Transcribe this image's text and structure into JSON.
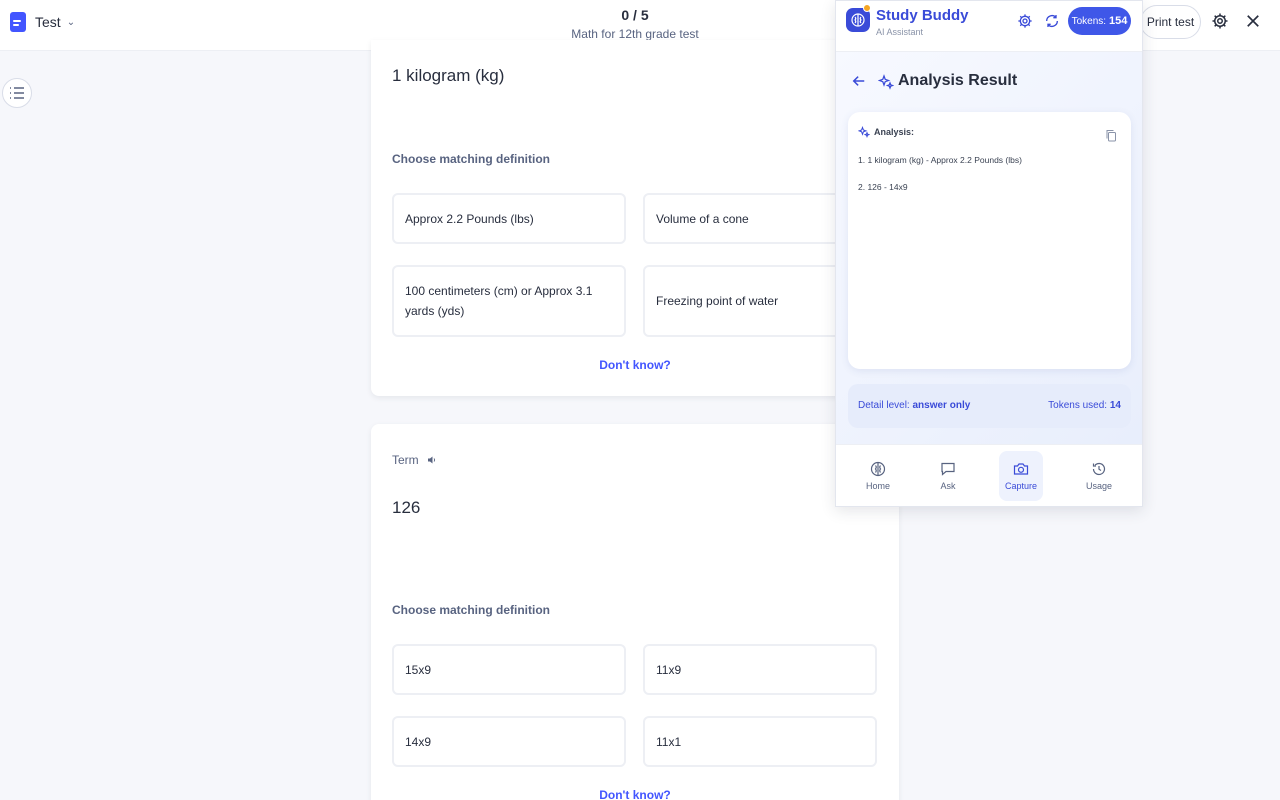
{
  "topbar": {
    "mode_label": "Test",
    "progress": "0 / 5",
    "test_title": "Math for 12th grade test",
    "print_label": "Print test"
  },
  "questions": [
    {
      "term": "1 kilogram (kg)",
      "choose_label": "Choose matching definition",
      "options": [
        "Approx 2.2 Pounds (lbs)",
        "Volume of a cone",
        "100 centimeters (cm) or Approx 3.1 yards (yds)",
        "Freezing point of water"
      ],
      "dont_know": "Don't know?"
    },
    {
      "term_label": "Term",
      "term": "126",
      "choose_label": "Choose matching definition",
      "options": [
        "15x9",
        "11x9",
        "14x9",
        "11x1"
      ],
      "dont_know": "Don't know?"
    }
  ],
  "study_buddy": {
    "title": "Study Buddy",
    "subtitle": "AI Assistant",
    "tokens_label": "Tokens:",
    "tokens_value": "154",
    "result_title": "Analysis Result",
    "analysis_label": "Analysis:",
    "analysis_lines": [
      "1. 1 kilogram (kg) - Approx 2.2 Pounds (lbs)",
      "2. 126 - 14x9"
    ],
    "detail_label": "Detail level:",
    "detail_value": "answer only",
    "tokens_used_label": "Tokens used:",
    "tokens_used_value": "14",
    "nav": [
      {
        "label": "Home",
        "icon": "brain-icon",
        "active": false
      },
      {
        "label": "Ask",
        "icon": "chat-icon",
        "active": false
      },
      {
        "label": "Capture",
        "icon": "camera-icon",
        "active": true
      },
      {
        "label": "Usage",
        "icon": "history-icon",
        "active": false
      }
    ]
  },
  "colors": {
    "accent": "#4255ff",
    "buddy_accent": "#3a4bd8",
    "background": "#f6f7fb"
  }
}
